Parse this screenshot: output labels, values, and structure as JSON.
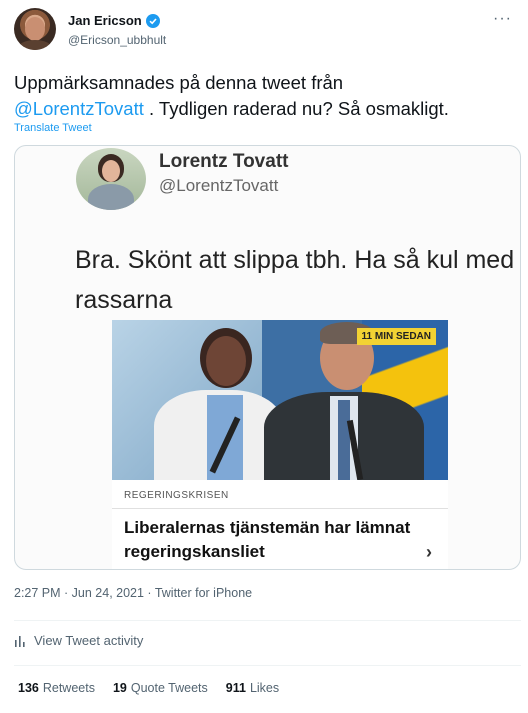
{
  "author": {
    "name": "Jan Ericson",
    "handle": "@Ericson_ubbhult",
    "verified": true,
    "more_label": "···"
  },
  "tweet": {
    "text_before": "Uppmärksamnades på denna tweet från",
    "mention": "@LorentzTovatt",
    "text_after": ". Tydligen raderad nu? Så osmakligt.",
    "translate_label": "Translate Tweet"
  },
  "media": {
    "inner_author_name": "Lorentz Tovatt",
    "inner_author_handle": "@LorentzTovatt",
    "inner_text": "Bra. Skönt att slippa tbh. Ha så kul med rassarna",
    "news": {
      "badge": "11 MIN SEDAN",
      "category": "REGERINGSKRISEN",
      "headline": "Liberalernas tjänstemän har lämnat regeringskansliet",
      "chevron": "›"
    }
  },
  "meta": {
    "time": "2:27 PM",
    "date": "Jun 24, 2021",
    "source": "Twitter for iPhone",
    "line": "2:27 PM · Jun 24, 2021 · Twitter for iPhone"
  },
  "activity_label": "View Tweet activity",
  "stats": {
    "retweets_count": "136",
    "retweets_label": "Retweets",
    "quotes_count": "19",
    "quotes_label": "Quote Tweets",
    "likes_count": "911",
    "likes_label": "Likes"
  },
  "colors": {
    "accent": "#1d9bf0",
    "text_primary": "#0f1419",
    "text_secondary": "#536471",
    "news_badge": "#f2d233"
  }
}
